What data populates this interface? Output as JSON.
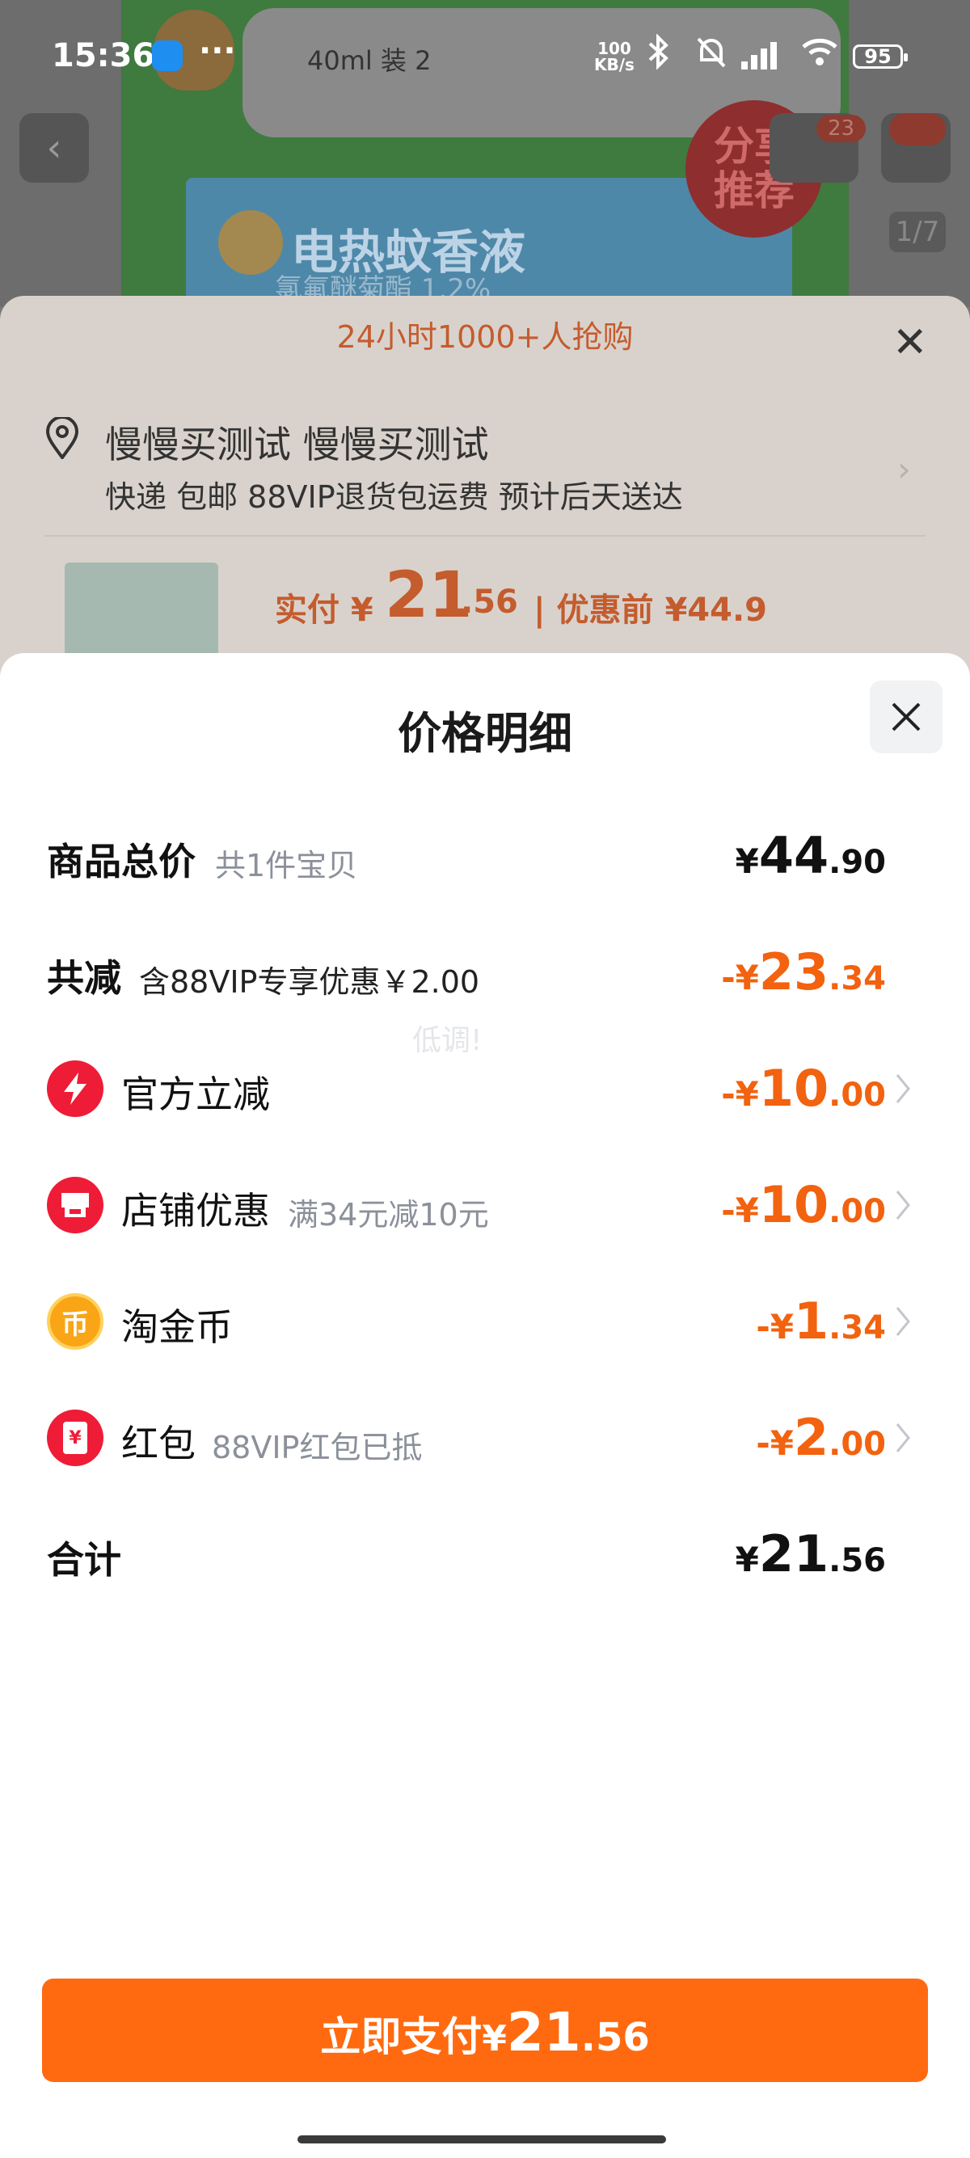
{
  "status_bar": {
    "time": "15:36",
    "net_speed_value": "100",
    "net_speed_unit": "KB/s",
    "battery": "95"
  },
  "background_page": {
    "product_banner_title": "电热蚊香液",
    "product_banner_sub": "氯氟醚菊酯 1.2%",
    "bubble_text": "40ml 装 2",
    "share_label_1": "分享",
    "share_label_2": "推荐",
    "cart_badge": "23",
    "image_counter": "1/7"
  },
  "checkout_sheet": {
    "banner": "24小时1000+人抢购",
    "address_name": "慢慢买测试 慢慢买测试",
    "address_line": "快递 包邮 88VIP退货包运费 预计后天送达",
    "pay_label": "实付 ¥",
    "pay_integer": "21",
    "pay_decimal": ".56",
    "pre_price": "| 优惠前 ¥44.9"
  },
  "price_detail": {
    "title": "价格明细",
    "watermark": "低调!",
    "rows": [
      {
        "label": "商品总价",
        "hint": "共1件宝贝",
        "currency": "¥",
        "int": "44",
        "dec": ".90",
        "color": "#111111"
      },
      {
        "label": "共减",
        "hint": "含88VIP专享优惠￥2.00",
        "currency": "-¥",
        "int": "23",
        "dec": ".34",
        "color": "#f2620f"
      },
      {
        "label": "官方立减",
        "hint": "",
        "icon": "lightning-icon",
        "currency": "-¥",
        "int": "10",
        "dec": ".00",
        "color": "#f2620f"
      },
      {
        "label": "店铺优惠",
        "hint": "满34元减10元",
        "icon": "shop-icon",
        "currency": "-¥",
        "int": "10",
        "dec": ".00",
        "color": "#f2620f"
      },
      {
        "label": "淘金币",
        "hint": "",
        "icon": "coin-icon",
        "currency": "-¥",
        "int": "1",
        "dec": ".34",
        "color": "#f2620f"
      },
      {
        "label": "红包",
        "hint": "88VIP红包已抵",
        "icon": "red-packet-icon",
        "currency": "-¥",
        "int": "2",
        "dec": ".00",
        "color": "#f2620f"
      },
      {
        "label": "合计",
        "hint": "",
        "currency": "¥",
        "int": "21",
        "dec": ".56",
        "color": "#111111"
      }
    ],
    "pay_button": {
      "label": "立即支付",
      "currency": "¥",
      "int": "21",
      "dec": ".56"
    },
    "coin_glyph": "币",
    "packet_glyph": "¥"
  }
}
